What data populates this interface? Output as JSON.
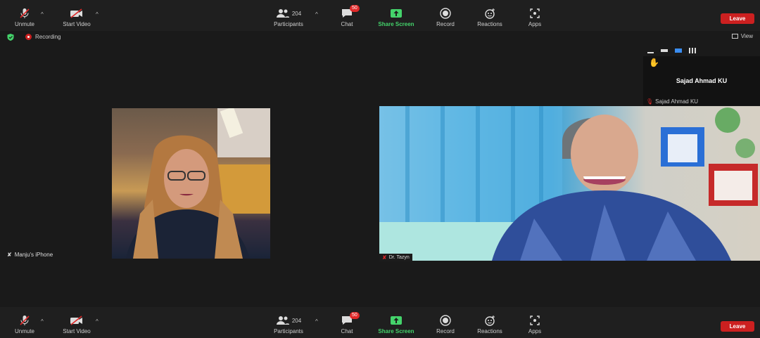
{
  "toolbar": {
    "unmute_label": "Unmute",
    "start_video_label": "Start Video",
    "participants_label": "Participants",
    "participants_count": "204",
    "chat_label": "Chat",
    "chat_badge": "50",
    "share_screen_label": "Share Screen",
    "record_label": "Record",
    "reactions_label": "Reactions",
    "apps_label": "Apps",
    "leave_label": "Leave"
  },
  "status": {
    "recording_label": "Recording",
    "view_label": "View"
  },
  "thumbnail": {
    "name": "Sajad Ahmad KU",
    "label": "Sajad Ahmad KU"
  },
  "participants": [
    {
      "name": "Manju's iPhone"
    },
    {
      "name": "Dr. Tazyn"
    }
  ],
  "colors": {
    "share_screen": "#44d36b",
    "leave": "#cc2020",
    "badge": "#e02828"
  }
}
